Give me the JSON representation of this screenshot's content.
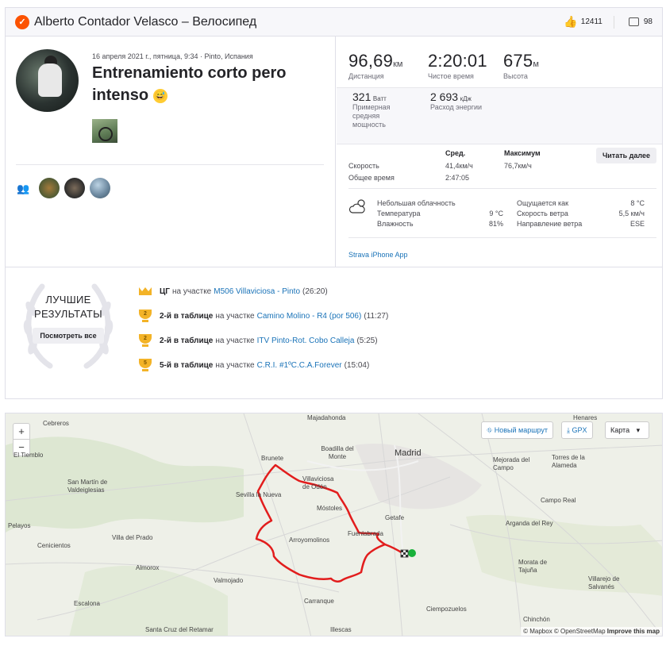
{
  "header": {
    "title": "Alberto Contador Velasco – Велосипед",
    "kudos_count": "12411",
    "comment_count": "98"
  },
  "activity": {
    "date": "16 апреля 2021 г., пятница, 9:34 · Pinto, Испания",
    "name": "Entrenamiento corto pero intenso",
    "emoji": "😅"
  },
  "stats": {
    "distance": {
      "value": "96,69",
      "unit": "км",
      "label": "Дистанция"
    },
    "moving_time": {
      "value": "2:20:01",
      "label": "Чистое время"
    },
    "elevation": {
      "value": "675",
      "unit": "м",
      "label": "Высота"
    },
    "power": {
      "value": "321",
      "unit": "Ватт",
      "label": "Примерная средняя мощность"
    },
    "energy": {
      "value": "2 693",
      "unit": "кДж",
      "label": "Расход энергии"
    }
  },
  "more": {
    "col_avg": "Сред.",
    "col_max": "Максимум",
    "read_more": "Читать далее",
    "speed_label": "Скорость",
    "speed_avg": "41,4км/ч",
    "speed_max": "76,7км/ч",
    "elapsed_label": "Общее время",
    "elapsed_avg": "2:47:05"
  },
  "weather": {
    "condition": "Небольшая облачность",
    "temp_label": "Температура",
    "temp_value": "9 °C",
    "humidity_label": "Влажность",
    "humidity_value": "81%",
    "feels_label": "Ощущается как",
    "feels_value": "8 °C",
    "wind_speed_label": "Скорость ветра",
    "wind_speed_value": "5,5 км/ч",
    "wind_dir_label": "Направление ветра",
    "wind_dir_value": "ESE"
  },
  "device": "Strava iPhone App",
  "achievements": {
    "best_line1": "ЛУЧШИЕ",
    "best_line2": "РЕЗУЛЬТАТЫ",
    "view_all": "Посмотреть все",
    "items": [
      {
        "bold": "ЦГ",
        "pre": "на участке",
        "segment": "M506 Villaviciosa - Pinto",
        "time": "(26:20)",
        "rank": ""
      },
      {
        "bold": "2-й в таблице",
        "pre": "на участке",
        "segment": "Camino Molino - R4 (por 506)",
        "time": "(11:27)",
        "rank": "2"
      },
      {
        "bold": "2-й в таблице",
        "pre": "на участке",
        "segment": "ITV Pinto-Rot. Cobo Calleja",
        "time": "(5:25)",
        "rank": "2"
      },
      {
        "bold": "5-й в таблице",
        "pre": "на участке",
        "segment": "C.R.I. #1ºC.C.A.Forever",
        "time": "(15:04)",
        "rank": "5"
      }
    ]
  },
  "map": {
    "zoom_in": "+",
    "zoom_out": "−",
    "new_route": "Новый маршрут",
    "gpx": "GPX",
    "map_type": "Карта",
    "attribution_mapbox": "© Mapbox",
    "attribution_osm": "© OpenStreetMap",
    "attribution_improve": "Improve this map",
    "places": {
      "majadahonda": "Majadahonda",
      "henares": "Henares",
      "cebreros": "Cebreros",
      "el_tiemblo": "El Tiemblo",
      "brunete": "Brunete",
      "boadilla": "Boadilla del Monte",
      "madrid": "Madrid",
      "mejorada": "Mejorada del Campo",
      "torres": "Torres de la Alameda",
      "san_martin": "San Martín de Valdeiglesias",
      "sevilla": "Sevilla la Nueva",
      "villaviciosa": "Villaviciosa de Odón",
      "mostoles": "Móstoles",
      "getafe": "Getafe",
      "campo_real": "Campo Real",
      "pelayos": "Pelayos",
      "cenicientos": "Cenicientos",
      "villa_prado": "Villa del Prado",
      "arroyomolinos": "Arroyomolinos",
      "fuenlabrada": "Fuenlabrada",
      "arganda": "Arganda del Rey",
      "morata": "Morata de Tajuña",
      "almorox": "Almorox",
      "valmojado": "Valmojado",
      "villarejo": "Villarejo de Salvanés",
      "escalona": "Escalona",
      "carranque": "Carranque",
      "ciempozuelos": "Ciempozuelos",
      "chinchon": "Chinchón",
      "santa_cruz": "Santa Cruz del Retamar",
      "illescas": "Illescas"
    }
  }
}
